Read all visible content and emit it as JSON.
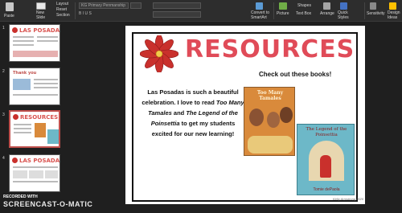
{
  "ribbon": {
    "paste_label": "Paste",
    "new_slide_label": "New\nSlide",
    "layout_label": "Layout",
    "reset_label": "Reset",
    "section_label": "Section",
    "font_combo": "KG Primary Penmanship",
    "convert_label": "Convert to\nSmartArt",
    "picture_label": "Picture",
    "shapes_label": "Shapes",
    "textbox_label": "Text Box",
    "arrange_label": "Arrange",
    "quick_styles_label": "Quick\nStyles",
    "sensitivity_label": "Sensitivity",
    "design_ideas_label": "Design\nIdeas"
  },
  "thumbnails": [
    {
      "number": "1",
      "title": "LAS POSADAS"
    },
    {
      "number": "2",
      "title": "Thank you"
    },
    {
      "number": "3",
      "title": "RESOURCES",
      "selected": true
    },
    {
      "number": "4",
      "title": "LAS POSADAS"
    }
  ],
  "slide": {
    "title": "RESOURCES",
    "subtitle": "Check out these books!",
    "body_pre": "Las Posadas is such a beautiful celebration. I love to read ",
    "book1_title": "Too Many Tamales",
    "body_mid": " and ",
    "book2_title": "The Legend of the Poinsettia",
    "body_post": " to get my students excited for our new learning!",
    "book1_cover_title": "Too Many Tamales",
    "book2_cover_title": "The Legend of the Poinsettia",
    "book2_cover_author": "Tomie dePaola",
    "credit": "Kelly Armstrong 2020"
  },
  "recording": {
    "label": "RECORDED WITH",
    "brand": "SCREENCAST-O-MATIC"
  },
  "colors": {
    "title_red": "#e04b58",
    "ribbon_bg": "#2d2d2d",
    "selected_border": "#c0504d"
  }
}
